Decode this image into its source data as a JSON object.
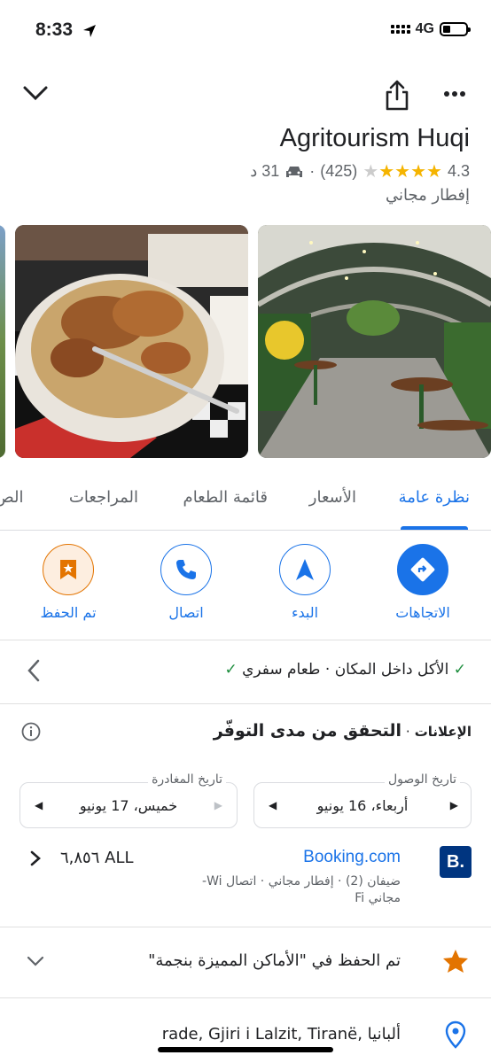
{
  "status": {
    "time": "8:33",
    "network": "4G"
  },
  "place": {
    "name": "Agritourism Huqi",
    "rating": "4.3",
    "reviews_count": "(425)",
    "drive_time": "31 د",
    "subtitle": "إفطار مجاني"
  },
  "tabs": [
    "نظرة عامة",
    "الأسعار",
    "قائمة الطعام",
    "المراجعات",
    "الص"
  ],
  "actions": {
    "directions": "الاتجاهات",
    "start": "البدء",
    "call": "اتصال",
    "saved": "تم الحفظ"
  },
  "dining": {
    "dine_in": "الأكل داخل المكان",
    "takeaway": "طعام سفري"
  },
  "availability": {
    "heading_prefix": "الإعلانات",
    "heading": "التحقق من مدى التوفّر",
    "checkin_label": "تاريخ الوصول",
    "checkin_value": "أربعاء، 16 يونيو",
    "checkout_label": "تاريخ المغادرة",
    "checkout_value": "خميس، 17 يونيو"
  },
  "booking": {
    "logo": "B.",
    "name": "Booking.com",
    "details_line1": "ضيفان (2) · إفطار مجاني · اتصال Wi-",
    "details_line2": "Fi مجاني",
    "price": "٦,٨٥٦ ALL"
  },
  "saved_list": {
    "text": "تم الحفظ في \"الأماكن المميزة بنجمة\""
  },
  "address": {
    "text": "rade, Gjiri i Lalzit, Tiranë, ألبانيا"
  },
  "colors": {
    "accent": "#1a73e8",
    "saved": "#e37400",
    "star": "#f5b400",
    "booking": "#003580"
  }
}
